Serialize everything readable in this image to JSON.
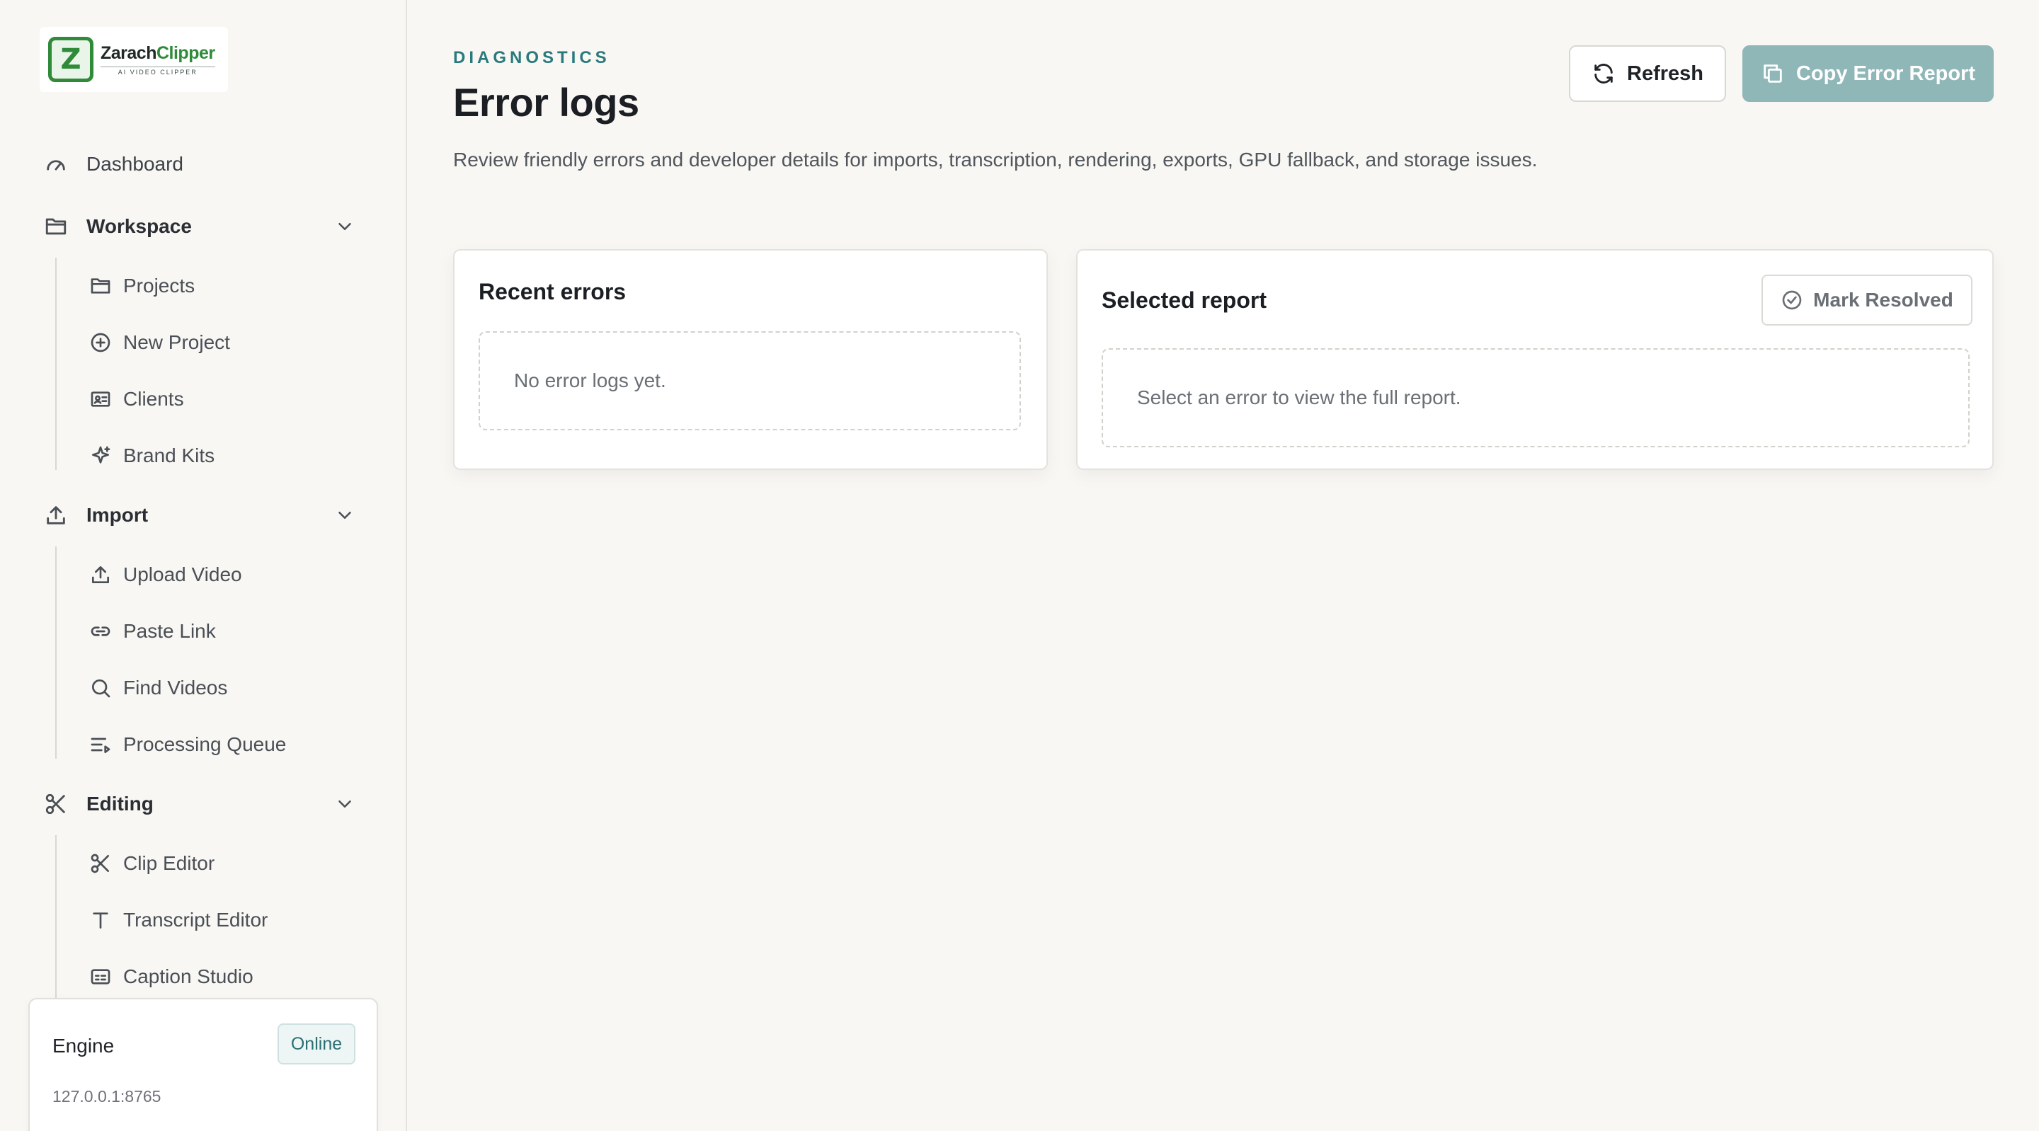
{
  "brand": {
    "name_part1": "Zarach",
    "name_part2": "Clipper",
    "tagline": "AI VIDEO CLIPPER",
    "mark": "Z",
    "accent_color": "#2f8a3a"
  },
  "sidebar": {
    "dashboard": {
      "label": "Dashboard",
      "icon": "gauge-icon"
    },
    "groups": [
      {
        "label": "Workspace",
        "icon": "folder-icon",
        "items": [
          {
            "label": "Projects",
            "icon": "folder-icon"
          },
          {
            "label": "New Project",
            "icon": "plus-circle-icon"
          },
          {
            "label": "Clients",
            "icon": "id-card-icon"
          },
          {
            "label": "Brand Kits",
            "icon": "sparkle-icon"
          }
        ]
      },
      {
        "label": "Import",
        "icon": "upload-icon",
        "items": [
          {
            "label": "Upload Video",
            "icon": "upload-icon"
          },
          {
            "label": "Paste Link",
            "icon": "link-icon"
          },
          {
            "label": "Find Videos",
            "icon": "search-icon"
          },
          {
            "label": "Processing Queue",
            "icon": "queue-icon"
          }
        ]
      },
      {
        "label": "Editing",
        "icon": "scissors-icon",
        "items": [
          {
            "label": "Clip Editor",
            "icon": "scissors-icon"
          },
          {
            "label": "Transcript Editor",
            "icon": "text-icon"
          },
          {
            "label": "Caption Studio",
            "icon": "captions-icon"
          }
        ]
      }
    ],
    "engine": {
      "title": "Engine",
      "status": "Online",
      "address": "127.0.0.1:8765",
      "status_color": "#2a6f72"
    }
  },
  "header": {
    "eyebrow": "DIAGNOSTICS",
    "title": "Error logs",
    "description": "Review friendly errors and developer details for imports, transcription, rendering, exports, GPU fallback, and storage issues.",
    "refresh_label": "Refresh",
    "copy_label": "Copy Error Report",
    "accent_color": "#8fb7b8"
  },
  "recent": {
    "title": "Recent errors",
    "empty_text": "No error logs yet."
  },
  "selected": {
    "title": "Selected report",
    "resolve_label": "Mark Resolved",
    "empty_text": "Select an error to view the full report."
  }
}
